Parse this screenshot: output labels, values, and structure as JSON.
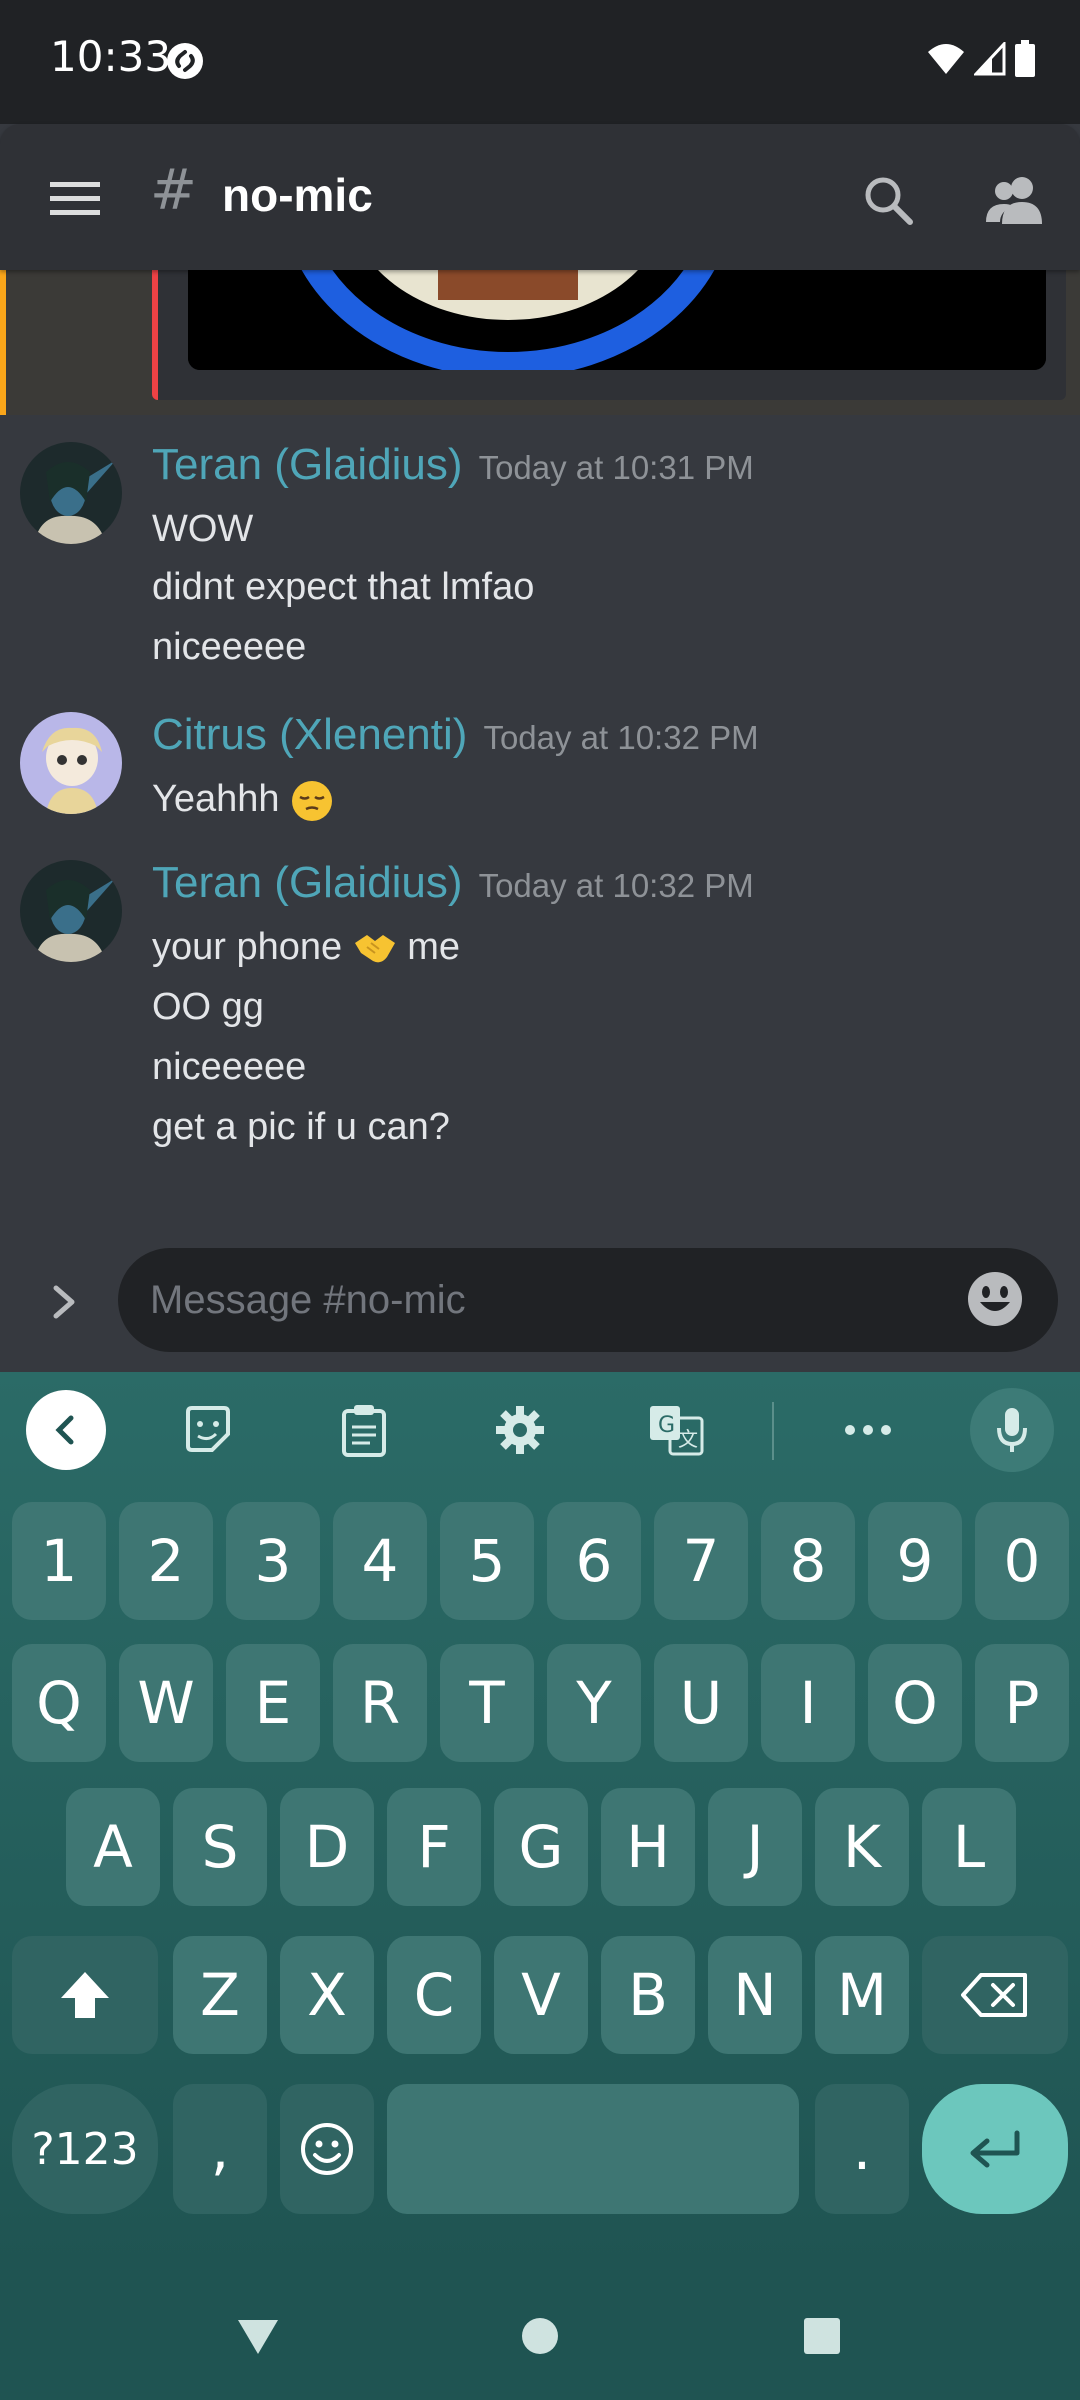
{
  "status_bar": {
    "time": "10:33"
  },
  "header": {
    "channel_name": "no-mic"
  },
  "messages": [
    {
      "author": "Teran (Glaidius)",
      "timestamp": "Today at 10:31 PM",
      "lines": [
        "WOW",
        "didnt expect that lmfao",
        "niceeeee"
      ]
    },
    {
      "author": "Citrus (Xlenenti)",
      "timestamp": "Today at 10:32 PM",
      "lines": [
        "Yeahhh"
      ]
    },
    {
      "author": "Teran (Glaidius)",
      "timestamp": "Today at 10:32 PM",
      "lines": [
        "your phone",
        "me",
        "OO gg",
        "niceeeee",
        "get a pic if u can?"
      ]
    }
  ],
  "composer": {
    "placeholder": "Message #no-mic"
  },
  "keyboard": {
    "row1": [
      "1",
      "2",
      "3",
      "4",
      "5",
      "6",
      "7",
      "8",
      "9",
      "0"
    ],
    "row2": [
      "Q",
      "W",
      "E",
      "R",
      "T",
      "Y",
      "U",
      "I",
      "O",
      "P"
    ],
    "row3": [
      "A",
      "S",
      "D",
      "F",
      "G",
      "H",
      "J",
      "K",
      "L"
    ],
    "row4": [
      "Z",
      "X",
      "C",
      "V",
      "B",
      "N",
      "M"
    ],
    "symbols_key": "?123",
    "comma_key": ",",
    "period_key": "."
  },
  "colors": {
    "accent_username": "#4fa6b8",
    "mention_highlight": "#faa61a",
    "keyboard_bg": "#2b6b67",
    "enter_key": "#6cc7bd"
  }
}
